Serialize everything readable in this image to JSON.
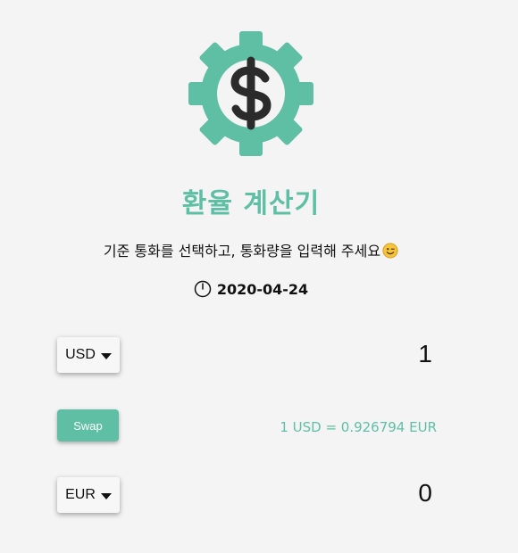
{
  "app": {
    "title": "환율 계산기",
    "subtitle": "기준 통화를 선택하고, 통화량을 입력해 주세요",
    "date": "2020-04-24",
    "brand_color": "#5fbfa5"
  },
  "icons": {
    "logo": "gear-dollar-icon",
    "subtitle_emoji": "winking-face-icon",
    "date": "clock-icon"
  },
  "from": {
    "currency": "USD",
    "amount": "1"
  },
  "swap": {
    "label": "Swap"
  },
  "rate": {
    "text": "1 USD = 0.926794 EUR"
  },
  "to": {
    "currency": "EUR",
    "amount": "0"
  }
}
